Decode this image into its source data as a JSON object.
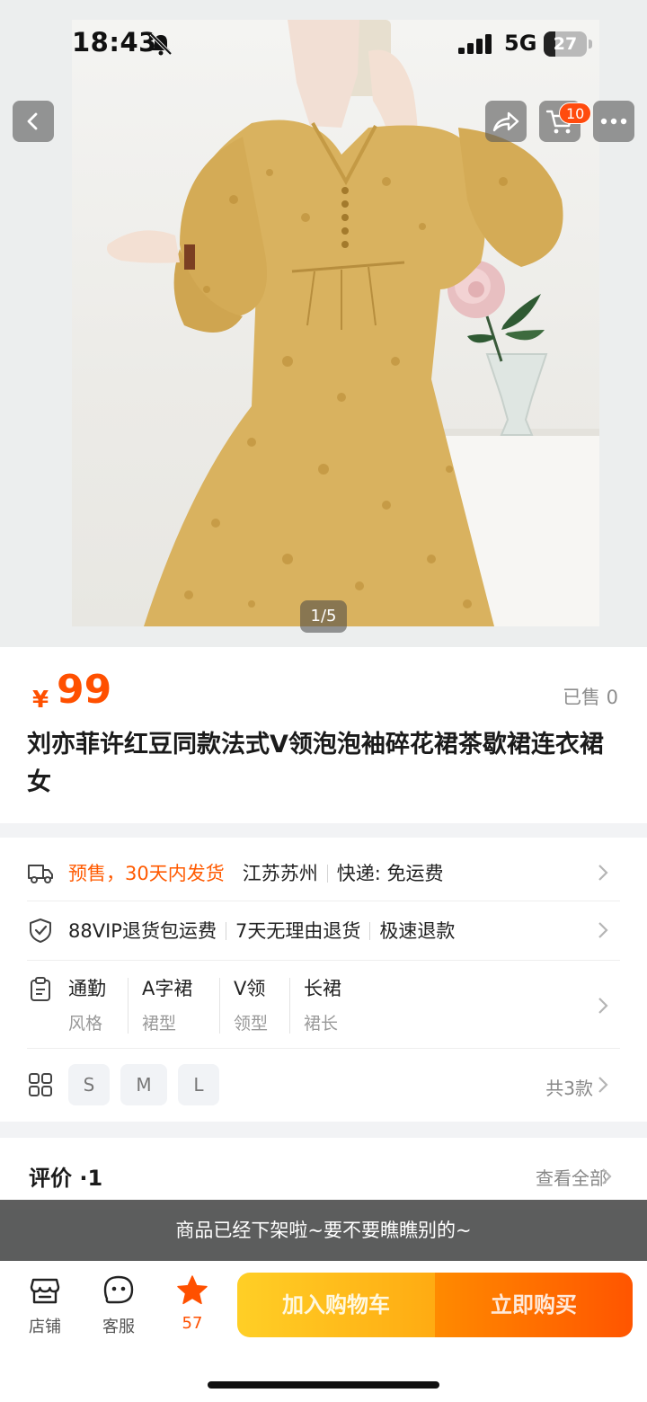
{
  "status_bar": {
    "time": "18:43",
    "network": "5G",
    "battery": "27",
    "battery_level_percent": 27,
    "icons": [
      "bell-slash-icon",
      "signal-bars-icon",
      "battery-icon"
    ]
  },
  "gallery": {
    "pager": "1/5",
    "cart_badge": "10",
    "nav_icons": [
      "back-arrow-icon",
      "share-icon",
      "cart-icon",
      "more-dots-icon"
    ]
  },
  "product": {
    "currency": "¥",
    "price": "99",
    "sold": "已售 0",
    "title": "刘亦菲许红豆同款法式Ⅴ领泡泡袖碎花裙茶歇裙连衣裙女"
  },
  "services": {
    "shipping": {
      "presale": "预售，30天内发货",
      "location": "江苏苏州",
      "express": "快递: 免运费"
    },
    "guarantees": [
      "88VIP退货包运费",
      "7天无理由退货",
      "极速退款"
    ],
    "attributes": [
      {
        "value": "通勤",
        "key": "风格"
      },
      {
        "value": "A字裙",
        "key": "裙型"
      },
      {
        "value": "V领",
        "key": "领型"
      },
      {
        "value": "长裙",
        "key": "裙长"
      }
    ],
    "sizes": [
      "S",
      "M",
      "L"
    ],
    "variant_count": "共3款"
  },
  "reviews": {
    "title": "评价 ·1",
    "view_all": "查看全部"
  },
  "notice": "商品已经下架啦~要不要瞧瞧别的~",
  "bottom_bar": {
    "shop": "店铺",
    "service": "客服",
    "favorites": "57",
    "add_to_cart": "加入购物车",
    "buy_now": "立即购买"
  },
  "colors": {
    "accent": "#ff5000",
    "cart_button": "#ffbf1d",
    "buy_button": "#ff6a00",
    "notice_bg": "#444444"
  }
}
